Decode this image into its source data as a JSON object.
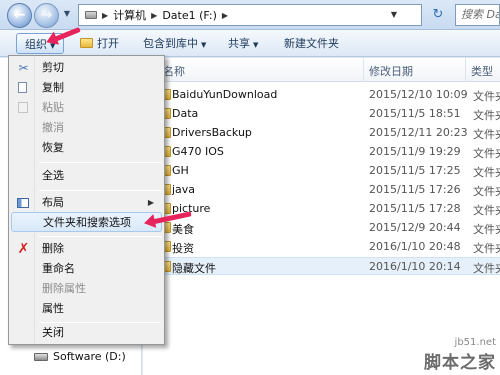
{
  "address": {
    "path": [
      "计算机",
      "Date1 (F:)"
    ],
    "search_placeholder": "搜索 Da"
  },
  "toolbar": {
    "organize": "组织",
    "open": "打开",
    "include_in_library": "包含到库中",
    "share": "共享",
    "new_folder": "新建文件夹"
  },
  "columns": {
    "name": "名称",
    "date_modified": "修改日期",
    "type": "类型"
  },
  "files": [
    {
      "name": "BaiduYunDownload",
      "date": "2015/12/10 10:09",
      "type": "文件夹"
    },
    {
      "name": "Data",
      "date": "2015/11/5 18:51",
      "type": "文件夹"
    },
    {
      "name": "DriversBackup",
      "date": "2015/12/11 20:23",
      "type": "文件夹"
    },
    {
      "name": "G470 IOS",
      "date": "2015/11/9 19:29",
      "type": "文件夹"
    },
    {
      "name": "GH",
      "date": "2015/11/5 17:25",
      "type": "文件夹"
    },
    {
      "name": "java",
      "date": "2015/11/5 17:26",
      "type": "文件夹"
    },
    {
      "name": "picture",
      "date": "2015/11/5 17:28",
      "type": "文件夹"
    },
    {
      "name": "美食",
      "date": "2015/12/9 20:44",
      "type": "文件夹"
    },
    {
      "name": "投资",
      "date": "2016/1/10 20:48",
      "type": "文件夹"
    },
    {
      "name": "隐藏文件",
      "date": "2016/1/10 20:14",
      "type": "文件夹"
    }
  ],
  "nav_pane": {
    "drive": "Software (D:)"
  },
  "menu": {
    "cut": "剪切",
    "copy": "复制",
    "paste": "粘贴",
    "undo": "撤消",
    "redo": "恢复",
    "select_all": "全选",
    "layout": "布局",
    "folder_options": "文件夹和搜索选项",
    "delete": "删除",
    "rename": "重命名",
    "remove_properties": "删除属性",
    "properties": "属性",
    "close": "关闭"
  },
  "watermark": {
    "site": "jb51.net",
    "brand": "脚本之家"
  },
  "colors": {
    "annotation_arrow": "#e8245c",
    "menu_highlight": "#d9e9fa"
  }
}
